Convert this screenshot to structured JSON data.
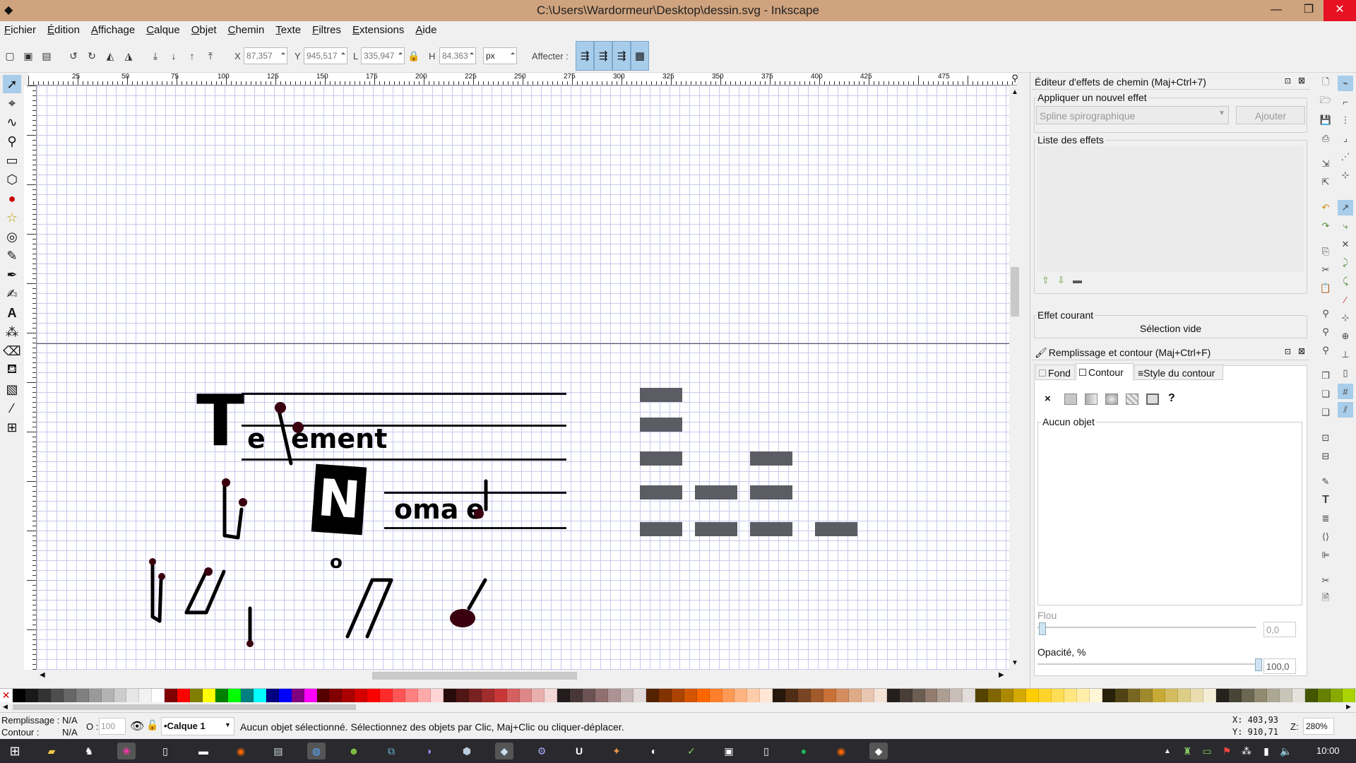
{
  "window": {
    "title": "C:\\Users\\Wardormeur\\Desktop\\dessin.svg - Inkscape",
    "minimize": "—",
    "maximize": "❐",
    "close": "✕"
  },
  "menu": [
    "Fichier",
    "Édition",
    "Affichage",
    "Calque",
    "Objet",
    "Chemin",
    "Texte",
    "Filtres",
    "Extensions",
    "Aide"
  ],
  "toolbar": {
    "x_label": "X",
    "x_value": "87,357",
    "y_label": "Y",
    "y_value": "945,517",
    "w_label": "L",
    "w_value": "335,947",
    "h_label": "H",
    "h_value": "84,363",
    "unit": "px",
    "affect_label": "Affecter :"
  },
  "ruler": {
    "labels": [
      "25",
      "50",
      "75",
      "100",
      "125",
      "150",
      "175",
      "200",
      "225",
      "250",
      "275",
      "300",
      "325",
      "350",
      "375",
      "400",
      "425",
      "475"
    ]
  },
  "canvas_text": {
    "t": "T",
    "word1": "e",
    "word1b": "ement",
    "n": "N",
    "word2a": "oma",
    "word2b": "e",
    "o": "o"
  },
  "lpe_dialog": {
    "title": "Éditeur d'effets de chemin (Maj+Ctrl+7)",
    "apply_group": "Appliquer un nouvel effet",
    "effect_select": "Spline spirographique",
    "add_button": "Ajouter",
    "list_group": "Liste des effets",
    "current_group": "Effet courant",
    "current_value": "Sélection vide"
  },
  "fill_dialog": {
    "title": "Remplissage et contour (Maj+Ctrl+F)",
    "tab_fill": "Fond",
    "tab_stroke": "Contour",
    "tab_style": "Style du contour",
    "none_label": "×",
    "unknown_label": "?",
    "no_object": "Aucun objet",
    "blur_label": "Flou",
    "blur_value": "0,0",
    "opacity_label": "Opacité, %",
    "opacity_value": "100,0"
  },
  "status": {
    "fill_label": "Remplissage :",
    "fill_value": "N/A",
    "stroke_label": "Contour :",
    "stroke_value": "N/A",
    "o_label": "O :",
    "o_value": "100",
    "layer": "•Calque 1",
    "message": "Aucun objet sélectionné. Sélectionnez des objets par Clic, Maj+Clic ou cliquer-déplacer.",
    "coord_x": "X: 403,93",
    "coord_y": "Y: 910,71",
    "zoom_label": "Z:",
    "zoom_value": "280%"
  },
  "taskbar": {
    "time": "10:00"
  },
  "palette": [
    "#000000",
    "#1a1a1a",
    "#333333",
    "#4d4d4d",
    "#666666",
    "#808080",
    "#999999",
    "#b3b3b3",
    "#cccccc",
    "#e6e6e6",
    "#f2f2f2",
    "#ffffff",
    "#800000",
    "#ff0000",
    "#808000",
    "#ffff00",
    "#008000",
    "#00ff00",
    "#008080",
    "#00ffff",
    "#000080",
    "#0000ff",
    "#800080",
    "#ff00ff",
    "#550000",
    "#800000",
    "#aa0000",
    "#d40000",
    "#ff0000",
    "#ff2a2a",
    "#ff5555",
    "#ff8080",
    "#ffaaaa",
    "#ffd5d5",
    "#280b0b",
    "#501616",
    "#782121",
    "#a02c2c",
    "#c83737",
    "#d35f5f",
    "#de8787",
    "#e9afaf",
    "#f4d7d7",
    "#241c1c",
    "#483737",
    "#6c5353",
    "#916f6f",
    "#ac9393",
    "#c8b7b7",
    "#e3dbdb",
    "#552200",
    "#803300",
    "#aa4400",
    "#d45500",
    "#ff6600",
    "#ff7f2a",
    "#ff9955",
    "#ffb380",
    "#ffccaa",
    "#ffe6d5",
    "#28170b",
    "#502d16",
    "#784421",
    "#a05a2c",
    "#c87137",
    "#d38d5f",
    "#deaa87",
    "#e9c6af",
    "#f4e3d7",
    "#241f1c",
    "#483e37",
    "#6c5d53",
    "#917c6f",
    "#ac9d93",
    "#c8beb7",
    "#e3dedb",
    "#554400",
    "#806600",
    "#aa8800",
    "#d4aa00",
    "#ffcc00",
    "#ffd42a",
    "#ffdd55",
    "#ffe680",
    "#ffeeaa",
    "#fff6d5",
    "#28220b",
    "#504416",
    "#786721",
    "#a0892c",
    "#c8ab37",
    "#d3bc5f",
    "#decd87",
    "#e9ddaf",
    "#f4eed7",
    "#24221c",
    "#484537",
    "#6c6753",
    "#918a6f",
    "#aca793",
    "#c8c4b7",
    "#e3e2db",
    "#445500",
    "#668000",
    "#88aa00",
    "#aad400"
  ]
}
